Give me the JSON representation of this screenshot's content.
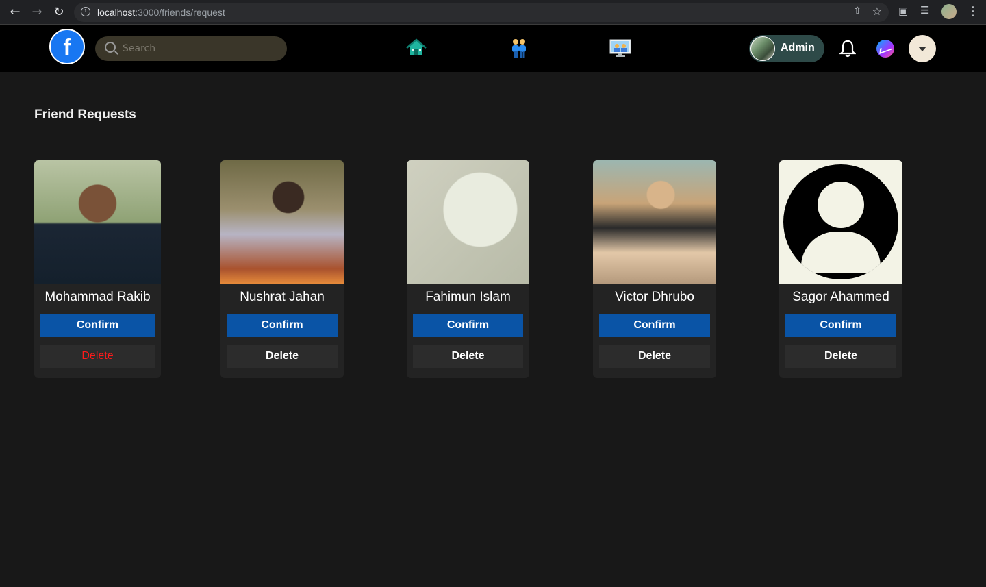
{
  "browser": {
    "url_host": "localhost",
    "url_path": ":3000/friends/request"
  },
  "header": {
    "search_placeholder": "Search",
    "admin_name": "Admin",
    "accent": "#1877f2"
  },
  "page": {
    "title": "Friend Requests"
  },
  "requests": [
    {
      "name": "Mohammad Rakib",
      "confirm_label": "Confirm",
      "delete_label": "Delete",
      "delete_color": "#ff1a1a"
    },
    {
      "name": "Nushrat Jahan",
      "confirm_label": "Confirm",
      "delete_label": "Delete"
    },
    {
      "name": "Fahimun Islam",
      "confirm_label": "Confirm",
      "delete_label": "Delete"
    },
    {
      "name": "Victor Dhrubo",
      "confirm_label": "Confirm",
      "delete_label": "Delete"
    },
    {
      "name": "Sagor Ahammed",
      "confirm_label": "Confirm",
      "delete_label": "Delete"
    }
  ],
  "colors": {
    "confirm_button": "#0a54a6",
    "delete_button": "#2c2c2c",
    "background": "#181818"
  }
}
